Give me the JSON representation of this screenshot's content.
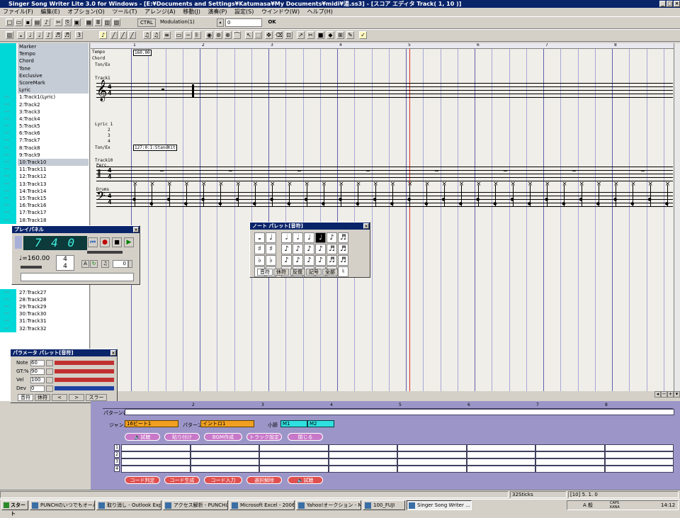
{
  "window": {
    "title": "Singer Song Writer Lite 3.0 for Windows - [E:¥Documents and Settings¥Katumasa¥My Documents¥midi¥湯.ss3] - [スコア エディタ Track( 1, 10 )]"
  },
  "menu": [
    "ファイル(F)",
    "編集(E)",
    "オプション(O)",
    "ツール(T)",
    "アレンジ(A)",
    "移動(J)",
    "演奏(P)",
    "設定(S)",
    "ウインドウ(W)",
    "ヘルプ(H)"
  ],
  "toolbar": {
    "ctrl_label": "CTRL",
    "modulation_label": "Modulation(1)",
    "value": "0",
    "ok_label": "OK"
  },
  "tracks": {
    "headers": [
      "Marker",
      "Tempo",
      "Chord",
      "Tone",
      "Exclusive",
      "ScoreMark",
      "Lyric"
    ],
    "items": [
      "1:Track1(Lyric)",
      "2:Track2",
      "3:Track3",
      "4:Track4",
      "5:Track5",
      "6:Track6",
      "7:Track7",
      "8:Track8",
      "9:Track9",
      "10:Track10",
      "11:Track11",
      "12:Track12",
      "13:Track13",
      "14:Track14",
      "15:Track15",
      "16:Track16",
      "17:Track17",
      "18:Track18",
      "27:Track27",
      "28:Track28",
      "29:Track29",
      "30:Track30",
      "31:Track31",
      "32:Track32"
    ],
    "selected": "10:Track10"
  },
  "score": {
    "ruler": [
      "1",
      "2",
      "3",
      "4",
      "5",
      "6",
      "7",
      "8"
    ],
    "row_labels": {
      "tempo": "Tempo",
      "chord": "Chord",
      "ton_ex": "Ton/Ex",
      "track1": "Track1",
      "lyric": "Lyric 1",
      "lyric_lines": [
        "2",
        "3",
        "4"
      ],
      "ton_ex2": "Ton/Ex",
      "track10": "Track10",
      "perc": "Perc.",
      "drums": "Drums"
    },
    "tempo_value": "160.00",
    "tone_value": "127:0:1:StandKit"
  },
  "play_panel": {
    "title": "プレイパネル",
    "counter": "7 4 0",
    "tempo": "♩=160.00",
    "transpose": "0"
  },
  "note_palette": {
    "title": "ノート パレット[音符]",
    "tabs": [
      "音符",
      "休符",
      "反復",
      "記号",
      "全部"
    ]
  },
  "param_palette": {
    "title": "パラメータ パレット[音符]",
    "rows": [
      {
        "label": "Note",
        "value": "60"
      },
      {
        "label": "GT:%",
        "value": "90"
      },
      {
        "label": "Vel",
        "value": "100"
      },
      {
        "label": "Dev",
        "value": "0"
      }
    ],
    "tabs": [
      "音符",
      "休符",
      "<",
      ">",
      "スラー"
    ]
  },
  "pattern": {
    "ruler": [
      "1",
      "2",
      "3",
      "4",
      "5",
      "6",
      "7",
      "8"
    ],
    "pattern_name_label": "パターン名",
    "genre_label": "ジャンル",
    "genre_value": "16ビート1",
    "pattern_label": "パターン",
    "pattern_value": "イントロ1",
    "measure_label": "小節",
    "measure_from": "M1",
    "measure_to": "M2",
    "buttons": [
      "試聴",
      "貼り付け",
      "BGM作成",
      "トラック設定",
      "閉じる"
    ],
    "rows": [
      "1",
      "2",
      "3",
      "4"
    ],
    "bottom_buttons": [
      "コード判定",
      "コード生成",
      "コード入力",
      "選択解除",
      "試聴"
    ]
  },
  "status": {
    "sticks": "32Sticks",
    "position": "[10]  5. 1.  0"
  },
  "taskbar": {
    "start": "スタート",
    "tasks": [
      "PUNCHのいつでもオーバー...",
      "取り消し - Outlook Expr...",
      "アクセス解析 - PUNCHの...",
      "Microsoft Excel - 2006b...",
      "Yahoo!オークション - Micr...",
      "100_FUJI",
      "Singer Song Writer ..."
    ],
    "ime": "A 般",
    "caps": "CAPS KANA",
    "clock": "14:12"
  }
}
